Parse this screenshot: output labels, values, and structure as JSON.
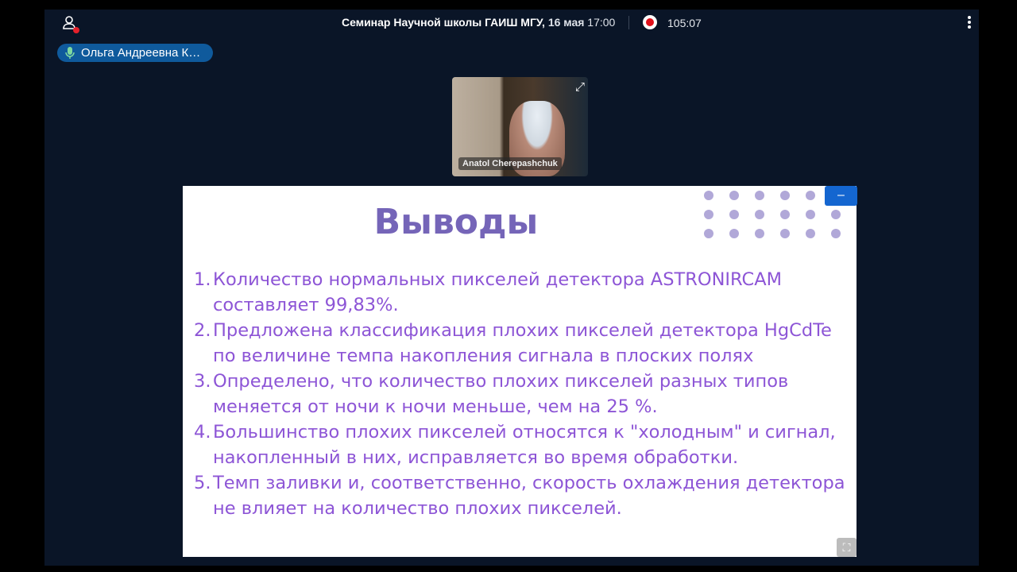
{
  "header": {
    "meeting_title": "Семинар Научной школы ГАИШ МГУ,",
    "date": "16 мая",
    "time": "17:00",
    "elapsed": "105:07"
  },
  "speaker_pill": {
    "name": "Ольга Андреевна К…"
  },
  "video": {
    "participant_name": "Anatol Cherepashchuk"
  },
  "slide": {
    "title": "Выводы",
    "items": [
      {
        "num": "1.",
        "text": "Количество нормальных пикселей детектора ASTRONIRCAM составляет 99,83%."
      },
      {
        "num": "2.",
        "text": "Предложена классификация плохих пикселей детектора HgCdTe по величине темпа накопления сигнала в плоских полях"
      },
      {
        "num": "3.",
        "text": "Определено, что количество плохих пикселей разных типов меняется от ночи к ночи  меньше, чем на 25 %."
      },
      {
        "num": "4.",
        "text": "Большинство плохих пикселей относятся к \"холодным\" и сигнал, накопленный в них, исправляется во время обработки."
      },
      {
        "num": "5.",
        "text": "Темп заливки и, соответственно, скорость охлаждения детектора не влияет на количество плохих пикселей."
      }
    ]
  },
  "controls": {
    "minimize": "–",
    "fullscreen": "⛶"
  }
}
